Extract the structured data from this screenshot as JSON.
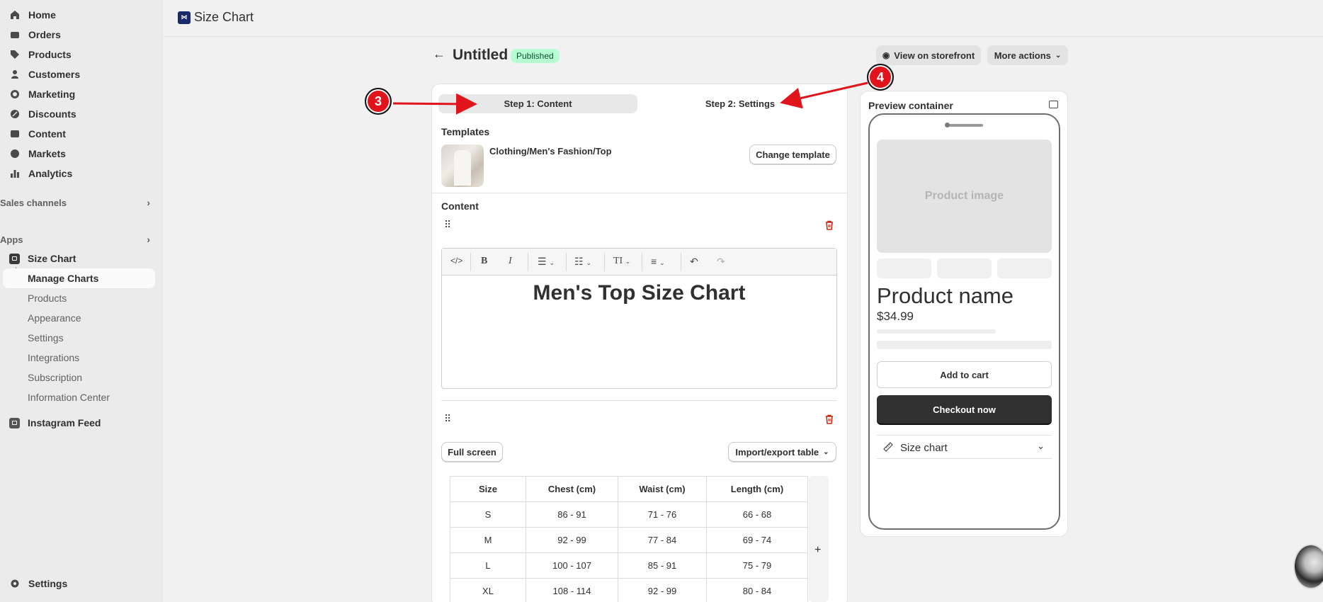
{
  "sidebar": {
    "nav": [
      {
        "label": "Home",
        "icon": "home-icon"
      },
      {
        "label": "Orders",
        "icon": "orders-icon"
      },
      {
        "label": "Products",
        "icon": "tag-icon"
      },
      {
        "label": "Customers",
        "icon": "person-icon"
      },
      {
        "label": "Marketing",
        "icon": "target-icon"
      },
      {
        "label": "Discounts",
        "icon": "discount-icon"
      },
      {
        "label": "Content",
        "icon": "image-icon"
      },
      {
        "label": "Markets",
        "icon": "globe-icon"
      },
      {
        "label": "Analytics",
        "icon": "bar-chart-icon"
      }
    ],
    "sales_channels": "Sales channels",
    "apps": "Apps",
    "app_size_chart": "Size Chart",
    "sub_items": [
      "Manage Charts",
      "Products",
      "Appearance",
      "Settings",
      "Integrations",
      "Subscription",
      "Information Center"
    ],
    "instagram": "Instagram Feed",
    "settings": "Settings"
  },
  "header": {
    "app_title": "Size Chart",
    "logo_glyph": "⋈"
  },
  "page": {
    "title": "Untitled",
    "status": "Published",
    "view_storefront": "View on storefront",
    "more_actions": "More actions"
  },
  "steps": {
    "step1": "Step 1: Content",
    "step2": "Step 2: Settings"
  },
  "templates": {
    "heading": "Templates",
    "name": "Clothing/Men's Fashion/Top",
    "change_button": "Change template"
  },
  "content": {
    "heading": "Content",
    "editor_heading": "Men's Top Size Chart",
    "full_screen": "Full screen",
    "import_export": "Import/export table",
    "add_column": "+"
  },
  "table": {
    "headers": [
      "Size",
      "Chest (cm)",
      "Waist (cm)",
      "Length (cm)"
    ],
    "rows": [
      [
        "S",
        "86 - 91",
        "71 - 76",
        "66 - 68"
      ],
      [
        "M",
        "92 - 99",
        "77 - 84",
        "69 - 74"
      ],
      [
        "L",
        "100 - 107",
        "85 - 91",
        "75 - 79"
      ],
      [
        "XL",
        "108 - 114",
        "92 - 99",
        "80 - 84"
      ]
    ]
  },
  "preview": {
    "title": "Preview container",
    "product_image": "Product image",
    "product_name": "Product name",
    "price": "$34.99",
    "add_to_cart": "Add to cart",
    "checkout": "Checkout now",
    "size_chart": "Size chart"
  },
  "annotations": {
    "marker3": "3",
    "marker4": "4",
    "color": "#e0141a"
  },
  "colors": {
    "published_bg": "#b4fed2",
    "published_text": "#0c5132",
    "trash": "#c5280c"
  }
}
